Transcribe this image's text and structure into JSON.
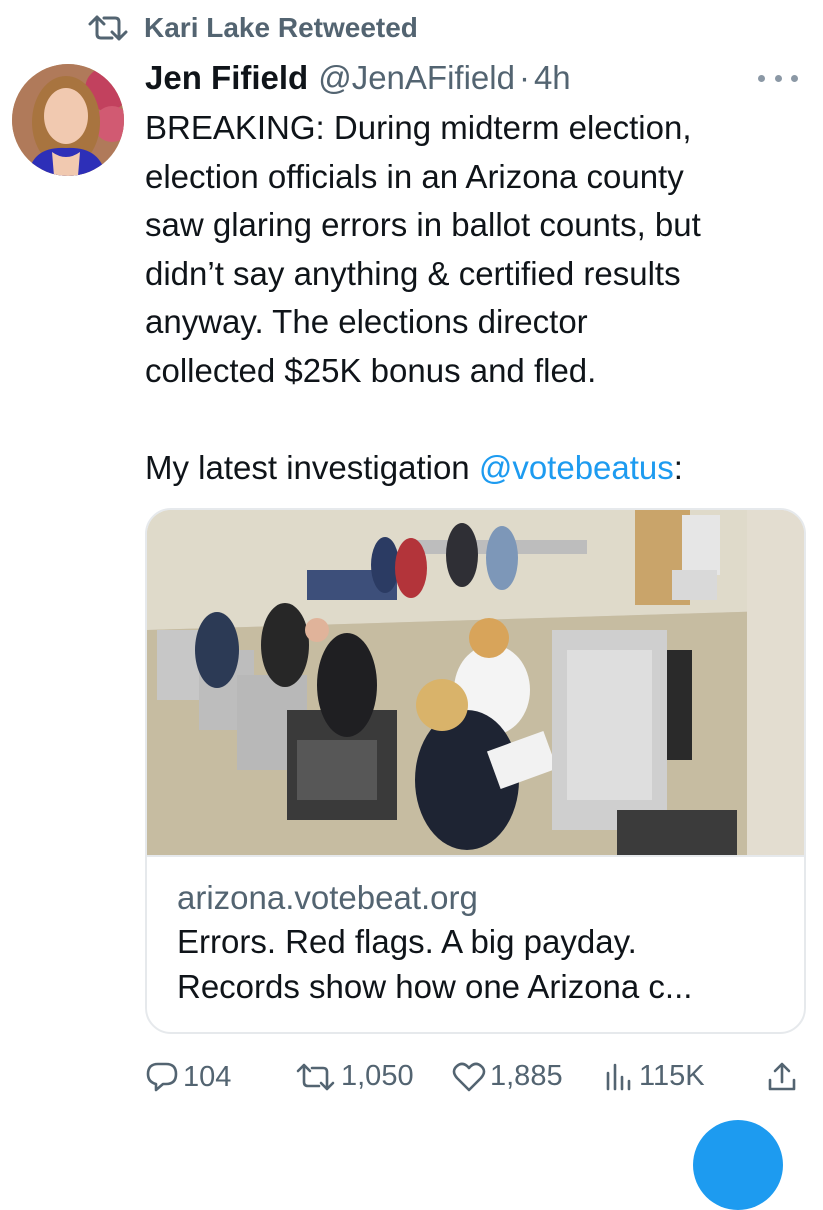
{
  "retweet": {
    "label": "Kari Lake Retweeted"
  },
  "tweet": {
    "author_name": "Jen Fifield",
    "author_handle": "@JenAFifield",
    "separator": "·",
    "time": "4h",
    "text_main": "BREAKING: During midterm election,\nelection officials in an Arizona county\nsaw glaring errors in ballot counts, but\ndidn’t say anything & certified results\nanyway. The elections director\ncollected $25K bonus and fled.",
    "text_investigation": "My latest investigation ",
    "mention": "@votebeatus",
    "text_colon": ":"
  },
  "card": {
    "domain": "arizona.votebeat.org",
    "title": "Errors. Red flags. A big payday.\nRecords show how one Arizona c..."
  },
  "actions": {
    "replies": "104",
    "retweets": "1,050",
    "likes": "1,885",
    "views": "115K"
  },
  "colors": {
    "accent": "#1d9bf0",
    "secondary_text": "#536471",
    "primary_text": "#0f1419"
  },
  "icons": [
    "retweet-icon",
    "more-icon",
    "reply-icon",
    "like-icon",
    "views-icon",
    "share-icon"
  ]
}
